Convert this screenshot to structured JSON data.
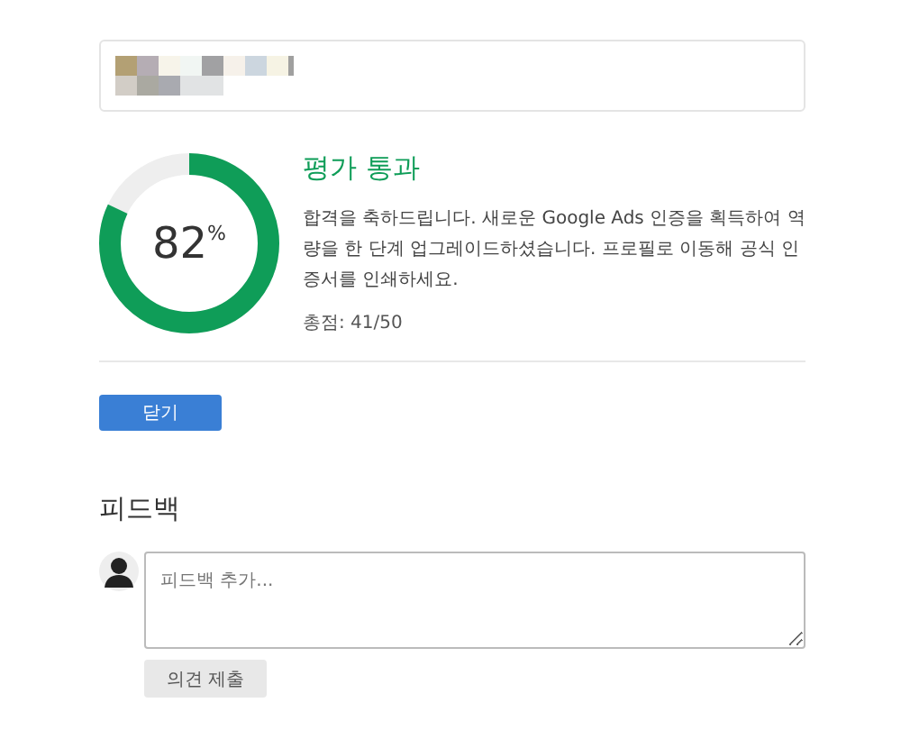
{
  "result": {
    "level": 0.82,
    "percent": "82",
    "percent_sign": "%",
    "title": "평가 통과",
    "message": "합격을 축하드립니다. 새로운 Google Ads 인증을 획득하여 역량을 한 단계 업그레이드하셨습니다. 프로필로 이동해 공식 인증서를 인쇄하세요.",
    "score": "총점: 41/50"
  },
  "close_button": "닫기",
  "feedback": {
    "heading": "피드백",
    "placeholder": "피드백 추가...",
    "submit": "의견 제출"
  }
}
